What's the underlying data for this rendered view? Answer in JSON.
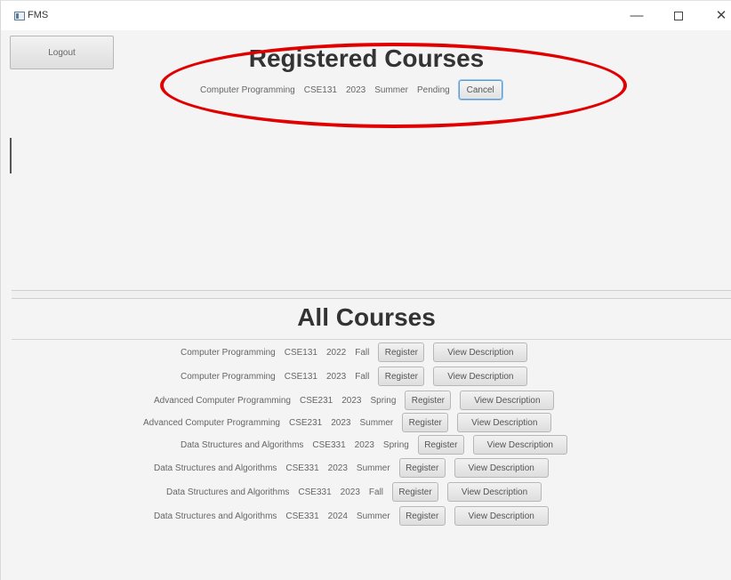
{
  "window": {
    "title": "FMS",
    "minimize": "—",
    "close": "✕"
  },
  "logout_label": "Logout",
  "registered": {
    "heading": "Registered Courses",
    "entry": {
      "name": "Computer Programming",
      "code": "CSE131",
      "year": "2023",
      "term": "Summer",
      "status": "Pending",
      "cancel_label": "Cancel"
    }
  },
  "annotation": {
    "color": "#e00000"
  },
  "all": {
    "heading": "All Courses",
    "register_label": "Register",
    "view_label": "View Description",
    "courses": [
      {
        "name": "Computer Programming",
        "code": "CSE131",
        "year": "2022",
        "term": "Fall"
      },
      {
        "name": "Computer Programming",
        "code": "CSE131",
        "year": "2023",
        "term": "Fall"
      },
      {
        "name": "Advanced Computer Programming",
        "code": "CSE231",
        "year": "2023",
        "term": "Spring"
      },
      {
        "name": "Advanced Computer Programming",
        "code": "CSE231",
        "year": "2023",
        "term": "Summer"
      },
      {
        "name": "Data Structures and Algorithms",
        "code": "CSE331",
        "year": "2023",
        "term": "Spring"
      },
      {
        "name": "Data Structures and Algorithms",
        "code": "CSE331",
        "year": "2023",
        "term": "Summer"
      },
      {
        "name": "Data Structures and Algorithms",
        "code": "CSE331",
        "year": "2023",
        "term": "Fall"
      },
      {
        "name": "Data Structures and Algorithms",
        "code": "CSE331",
        "year": "2024",
        "term": "Summer"
      }
    ]
  }
}
